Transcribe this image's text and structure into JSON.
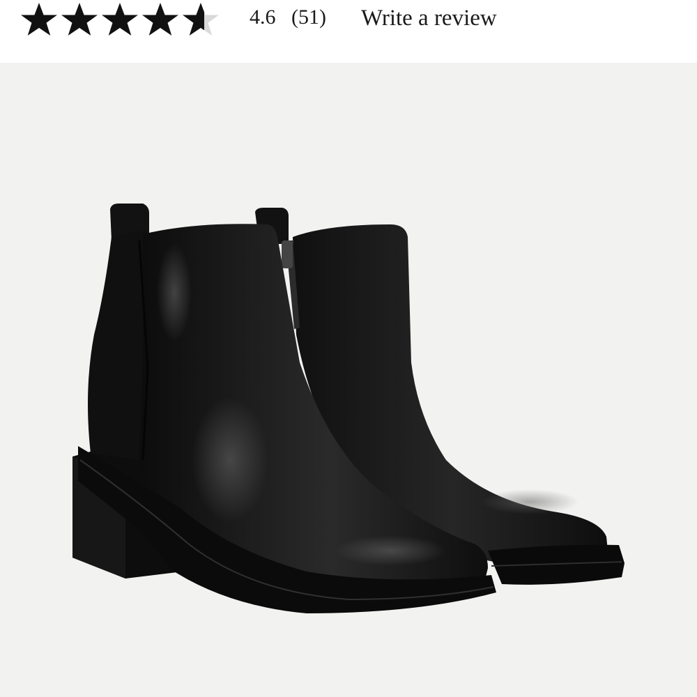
{
  "rating": {
    "value": "4.6",
    "count": "(51)",
    "write_review_label": "Write a review",
    "stars_filled": 4.6,
    "stars_total": 5,
    "star_color": "#111111",
    "star_empty_color": "#d9d9d9"
  },
  "product_image": {
    "icon": "ankle-boots-photo",
    "background_color": "#f2f2f0",
    "boot_color": "#141414"
  }
}
